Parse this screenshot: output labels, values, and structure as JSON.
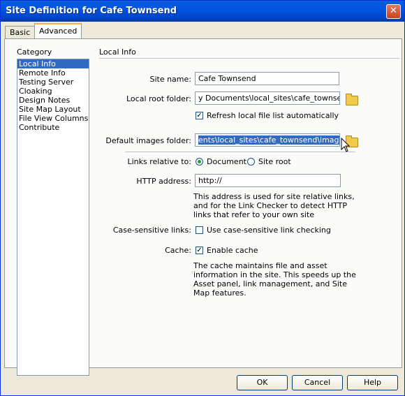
{
  "window": {
    "title": "Site Definition for Cafe Townsend",
    "close_glyph": "✕"
  },
  "tabs": [
    {
      "label": "Basic"
    },
    {
      "label": "Advanced"
    }
  ],
  "category": {
    "heading": "Category",
    "items": [
      {
        "label": "Local Info",
        "selected": true
      },
      {
        "label": "Remote Info"
      },
      {
        "label": "Testing Server"
      },
      {
        "label": "Cloaking"
      },
      {
        "label": "Design Notes"
      },
      {
        "label": "Site Map Layout"
      },
      {
        "label": "File View Columns"
      },
      {
        "label": "Contribute"
      }
    ]
  },
  "section": {
    "heading": "Local Info"
  },
  "form": {
    "site_name_label": "Site name:",
    "site_name_value": "Cafe Townsend",
    "local_root_label": "Local root folder:",
    "local_root_value": "y Documents\\local_sites\\cafe_townsend\\",
    "refresh_label": "Refresh local file list automatically",
    "refresh_checked": true,
    "default_images_label": "Default images folder:",
    "default_images_value": "ents\\local_sites\\cafe_townsend\\images\\",
    "links_relative_label": "Links relative to:",
    "links_document_label": "Document",
    "links_siteroot_label": "Site root",
    "links_selected": "Document",
    "http_label": "HTTP address:",
    "http_value": "http://",
    "http_help": [
      "This address is used for site relative links,",
      "and for the Link Checker to detect HTTP",
      "links that refer to your own site"
    ],
    "case_label": "Case-sensitive links:",
    "case_option_label": "Use case-sensitive link checking",
    "case_checked": false,
    "cache_label": "Cache:",
    "cache_option_label": "Enable cache",
    "cache_checked": true,
    "cache_help": [
      "The cache maintains file and asset",
      "information in the site.  This speeds up the",
      "Asset panel, link management, and Site",
      "Map features."
    ]
  },
  "buttons": {
    "ok": "OK",
    "cancel": "Cancel",
    "help": "Help"
  },
  "colors": {
    "titlebar": "#0054e3",
    "selection": "#316ac5",
    "dialog_bg": "#ece9d8"
  }
}
